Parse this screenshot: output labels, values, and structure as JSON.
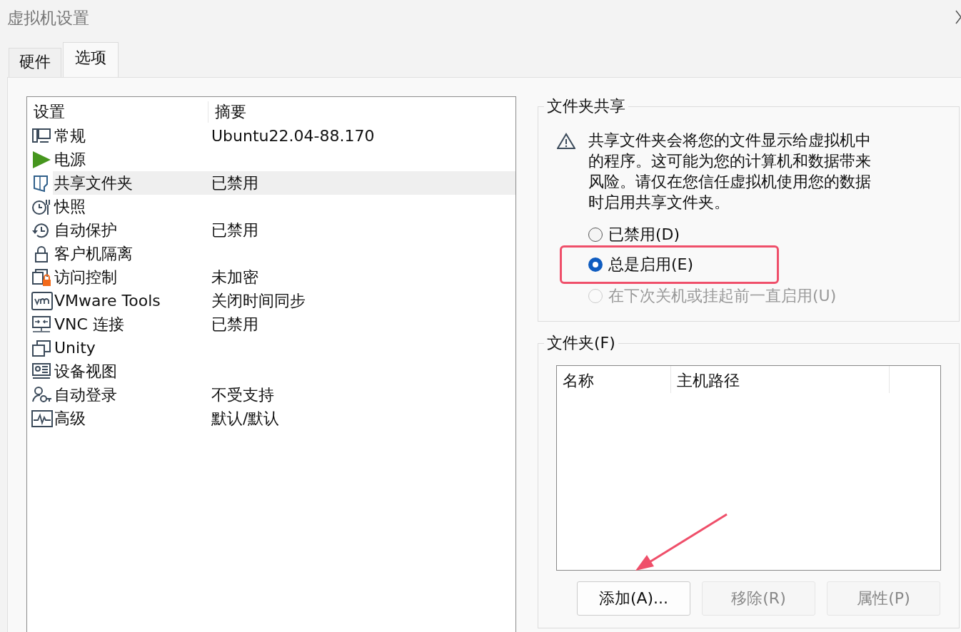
{
  "window": {
    "title": "虚拟机设置"
  },
  "tabs": [
    {
      "label": "硬件",
      "selected": false
    },
    {
      "label": "选项",
      "selected": true
    }
  ],
  "settings": {
    "columns": [
      "设置",
      "摘要"
    ],
    "rows": [
      {
        "name": "常规",
        "summary": "Ubuntu22.04-88.170",
        "selected": false
      },
      {
        "name": "电源",
        "selected": false
      },
      {
        "name": "共享文件夹",
        "summary": "已禁用",
        "selected": true
      },
      {
        "name": "快照",
        "selected": false
      },
      {
        "name": "自动保护",
        "summary": "已禁用",
        "selected": false
      },
      {
        "name": "客户机隔离",
        "selected": false
      },
      {
        "name": "访问控制",
        "summary": "未加密",
        "selected": false
      },
      {
        "name": "VMware Tools",
        "summary": "关闭时间同步",
        "selected": false
      },
      {
        "name": "VNC 连接",
        "summary": "已禁用",
        "selected": false
      },
      {
        "name": "Unity",
        "selected": false
      },
      {
        "name": "设备视图",
        "selected": false
      },
      {
        "name": "自动登录",
        "summary": "不受支持",
        "selected": false
      },
      {
        "name": "高级",
        "summary": "默认/默认",
        "selected": false
      }
    ]
  },
  "sharing": {
    "title": "文件夹共享",
    "warning": "共享文件夹会将您的文件显示给虚拟机中的程序。这可能为您的计算机和数据带来风险。请仅在您信任虚拟机使用您的数据时启用共享文件夹。",
    "options": [
      {
        "label": "已禁用(D)",
        "selected": false,
        "disabled": false,
        "highlighted": false
      },
      {
        "label": "总是启用(E)",
        "selected": true,
        "disabled": false,
        "highlighted": true
      },
      {
        "label": "在下次关机或挂起前一直启用(U)",
        "selected": false,
        "disabled": true,
        "highlighted": false
      }
    ]
  },
  "folders": {
    "title": "文件夹(F)",
    "columns": [
      "名称",
      "主机路径"
    ],
    "buttons": [
      {
        "label": "添加(A)...",
        "disabled": false
      },
      {
        "label": "移除(R)",
        "disabled": true
      },
      {
        "label": "属性(P)",
        "disabled": true
      }
    ]
  }
}
